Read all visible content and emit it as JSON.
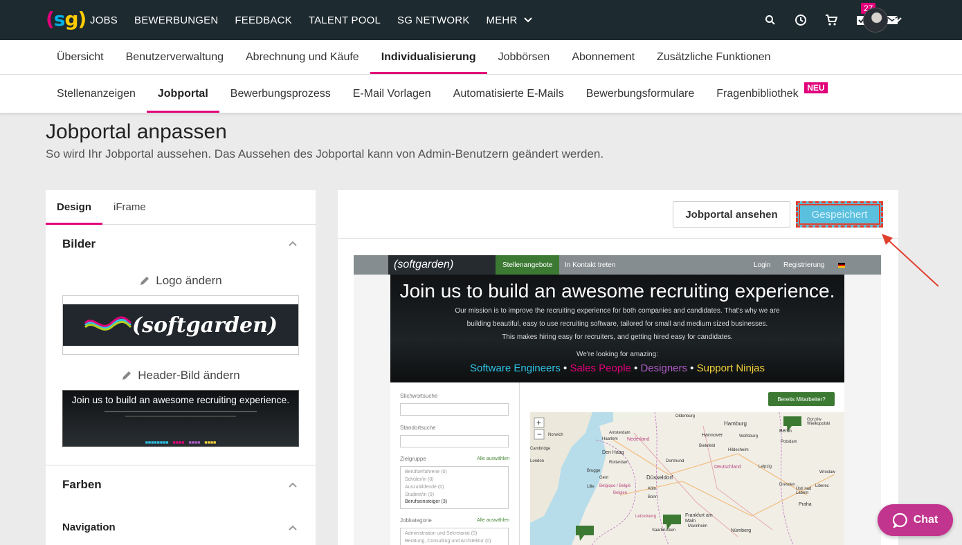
{
  "topnav": {
    "logo": {
      "open": "(",
      "s": "s",
      "g": "g",
      "close": ")"
    },
    "items": [
      "JOBS",
      "BEWERBUNGEN",
      "FEEDBACK",
      "TALENT POOL",
      "SG NETWORK"
    ],
    "more_label": "MEHR",
    "tasks_badge": "27",
    "icons": [
      "search-icon",
      "clock-icon",
      "cart-icon",
      "tasks-icon",
      "mail-icon"
    ]
  },
  "tabs_primary": [
    "Übersicht",
    "Benutzerverwaltung",
    "Abrechnung und Käufe",
    "Individualisierung",
    "Jobbörsen",
    "Abonnement",
    "Zusätzliche Funktionen"
  ],
  "tabs_primary_active": "Individualisierung",
  "tabs_secondary": [
    "Stellenanzeigen",
    "Jobportal",
    "Bewerbungsprozess",
    "E-Mail Vorlagen",
    "Automatisierte E-Mails",
    "Bewerbungsformulare",
    "Fragenbibliothek"
  ],
  "tabs_secondary_active": "Jobportal",
  "new_badge": "NEU",
  "page": {
    "title": "Jobportal anpassen",
    "subtitle": "So wird Ihr Jobportal aussehen. Das Aussehen des Jobportal kann von Admin-Benutzern geändert werden."
  },
  "left_panel": {
    "tabs": [
      "Design",
      "iFrame"
    ],
    "sections": {
      "images": "Bilder",
      "logo_change": "Logo ändern",
      "header_change": "Header-Bild ändern",
      "colors": "Farben",
      "navigation": "Navigation"
    },
    "logo_text": "(softgarden)",
    "header_thumb_text": "Join us to build an awesome recruiting experience."
  },
  "right_panel": {
    "view_button": "Jobportal ansehen",
    "saved_button": "Gespeichert"
  },
  "preview": {
    "logo": "(softgarden)",
    "nav_active": "Stellenangebote",
    "nav_contact": "In Kontakt treten",
    "nav_login": "Login",
    "nav_register": "Registrierung",
    "hero_title": "Join us to build an awesome recruiting experience.",
    "hero_line1": "Our mission is to improve the recruiting experience for both companies and candidates. That's why we are",
    "hero_line2": "building beautiful, easy to use recruiting software, tailored for small and medium sized businesses.",
    "hero_line3": "This makes hiring easy for recruiters, and getting hired easy for candidates.",
    "hero_looking": "We're looking for amazing:",
    "tags": [
      "Software Engineers",
      "Sales People",
      "Designers",
      "Support Ninjas"
    ],
    "tag_colors": [
      "#2ec4e8",
      "#e2007a",
      "#b05cc8",
      "#f3d23b"
    ],
    "keyword_label": "Stichwortsuche",
    "location_label": "Standortsuche",
    "target_label": "Zielgruppe",
    "select_all": "Alle auswählen",
    "target_items": [
      "Berufserfahrene (0)",
      "Schüler/in (0)",
      "Auszubildende (0)",
      "Student/in (0)",
      "Berufseinsteiger (3)"
    ],
    "category_label": "Jobkategorie",
    "category_items": [
      "Administration und Sekretariat (0)",
      "Beratung, Consulting und Architektur (0)"
    ],
    "employee_button": "Bereits Mitarbeiter?",
    "map_labels": [
      "Oldenburg",
      "Hamburg",
      "Hannover",
      "Wolfsburg",
      "Berlin",
      "Gorzów Wielkopolski",
      "Norwich",
      "Haarlem",
      "Amsterdam",
      "Nederland",
      "Den Haag",
      "Rotterdam",
      "Bielefeld",
      "Hildesheim",
      "Potsdam",
      "Dortmund",
      "Düsseldorf",
      "Deutschland",
      "Leipzig",
      "Brugge",
      "Gent",
      "Lille",
      "Belgique / België",
      "Belgien",
      "Köln",
      "Bonn",
      "Frankfurt am Main",
      "Mannheim",
      "Nürnberg",
      "Saarbrücken",
      "Letzebuerg",
      "Dresden",
      "Praha",
      "Ústí nad Labem",
      "Liberec",
      "Wrocław",
      "Cambridge",
      "London"
    ]
  },
  "chat_label": "Chat"
}
